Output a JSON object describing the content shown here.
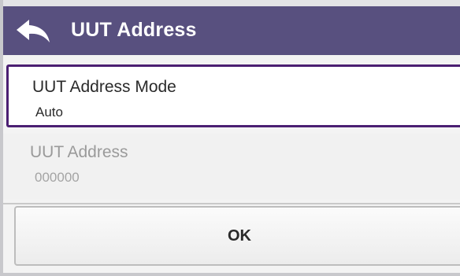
{
  "header": {
    "title": "UUT Address",
    "back_icon": "back-arrow-icon",
    "background_color": "#58507f"
  },
  "settings": {
    "mode": {
      "label": "UUT Address Mode",
      "value": "Auto"
    },
    "address": {
      "label": "UUT Address",
      "value": "000000"
    }
  },
  "footer": {
    "ok_label": "OK"
  },
  "colors": {
    "selected_border": "#4b1f72",
    "disabled_text": "#9a9a9a"
  }
}
